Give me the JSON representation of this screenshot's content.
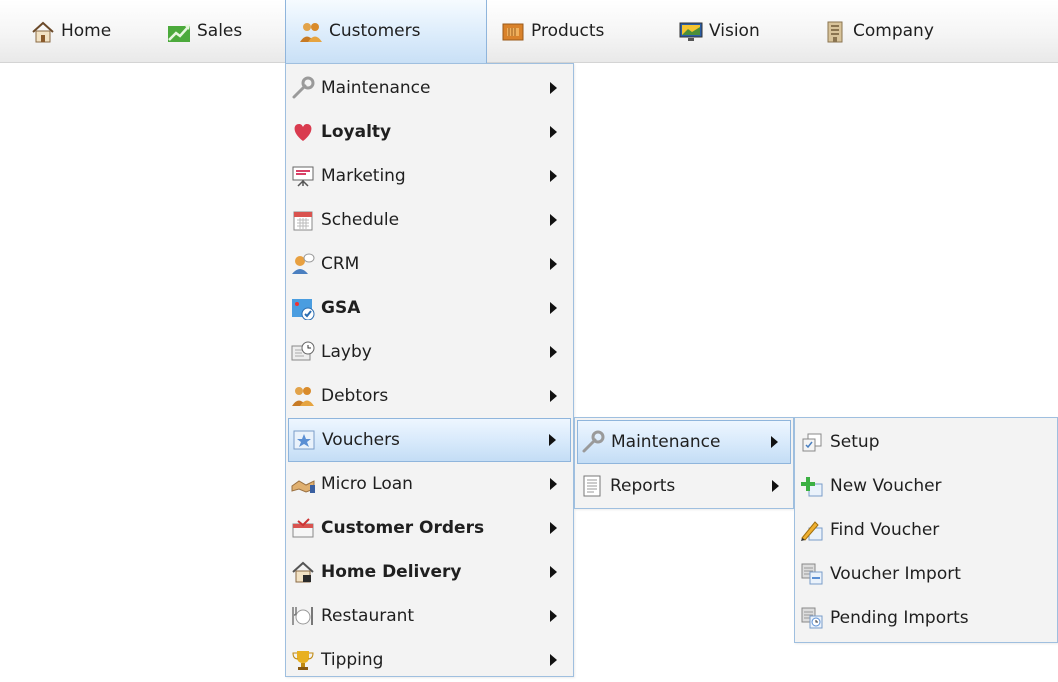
{
  "menubar": {
    "items": [
      {
        "label": "Home",
        "icon": "home-icon"
      },
      {
        "label": "Sales",
        "icon": "sales-chart-icon"
      },
      {
        "label": "Customers",
        "icon": "customers-icon"
      },
      {
        "label": "Products",
        "icon": "products-box-icon"
      },
      {
        "label": "Vision",
        "icon": "vision-monitor-icon"
      },
      {
        "label": "Company",
        "icon": "company-building-icon"
      }
    ],
    "active": "Customers"
  },
  "customers_menu": {
    "items": [
      {
        "label": "Maintenance",
        "icon": "wrench-icon",
        "bold": false,
        "submenu": true
      },
      {
        "label": "Loyalty",
        "icon": "heart-icon",
        "bold": true,
        "submenu": true
      },
      {
        "label": "Marketing",
        "icon": "presentation-board-icon",
        "bold": false,
        "submenu": true
      },
      {
        "label": "Schedule",
        "icon": "calendar-icon",
        "bold": false,
        "submenu": true
      },
      {
        "label": "CRM",
        "icon": "person-speech-icon",
        "bold": false,
        "submenu": true
      },
      {
        "label": "GSA",
        "icon": "gsa-check-icon",
        "bold": true,
        "submenu": true
      },
      {
        "label": "Layby",
        "icon": "layby-clock-icon",
        "bold": false,
        "submenu": true
      },
      {
        "label": "Debtors",
        "icon": "debtors-people-icon",
        "bold": false,
        "submenu": true
      },
      {
        "label": "Vouchers",
        "icon": "voucher-star-icon",
        "bold": false,
        "submenu": true
      },
      {
        "label": "Micro Loan",
        "icon": "handshake-icon",
        "bold": false,
        "submenu": true
      },
      {
        "label": "Customer Orders",
        "icon": "orders-cart-icon",
        "bold": true,
        "submenu": true
      },
      {
        "label": "Home Delivery",
        "icon": "home-delivery-icon",
        "bold": true,
        "submenu": true
      },
      {
        "label": "Restaurant",
        "icon": "restaurant-cutlery-icon",
        "bold": false,
        "submenu": true
      },
      {
        "label": "Tipping",
        "icon": "trophy-icon",
        "bold": false,
        "submenu": true
      }
    ],
    "highlighted": "Vouchers"
  },
  "vouchers_menu": {
    "items": [
      {
        "label": "Maintenance",
        "icon": "wrench-icon",
        "submenu": true
      },
      {
        "label": "Reports",
        "icon": "report-document-icon",
        "submenu": true
      }
    ],
    "highlighted": "Maintenance"
  },
  "maintenance_menu": {
    "items": [
      {
        "label": "Setup",
        "icon": "setup-icon"
      },
      {
        "label": "New Voucher",
        "icon": "new-voucher-plus-icon"
      },
      {
        "label": "Find Voucher",
        "icon": "find-voucher-pencil-icon"
      },
      {
        "label": "Voucher Import",
        "icon": "voucher-import-icon"
      },
      {
        "label": "Pending Imports",
        "icon": "pending-imports-icon"
      }
    ]
  },
  "colors": {
    "highlight_border": "#8fb5dc",
    "menu_background": "#f3f3f3"
  }
}
